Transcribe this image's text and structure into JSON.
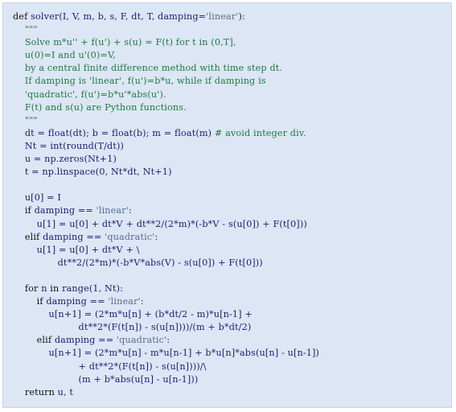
{
  "code_listing": {
    "language": "python",
    "colors": {
      "background": "#dce6f5",
      "keyword": "#111111",
      "identifier": "#1c1c70",
      "string": "#5a6e8c",
      "comment": "#1f7a3f"
    },
    "lines": [
      [
        {
          "t": "kw",
          "v": "def "
        },
        {
          "t": "id",
          "v": "solver(I, V, m, b, s, F, dt, T, damping="
        },
        {
          "t": "str",
          "v": "'linear'"
        },
        {
          "t": "id",
          "v": "):"
        }
      ],
      [
        {
          "t": "cm",
          "v": "    \"\"\""
        }
      ],
      [
        {
          "t": "cm",
          "v": "    Solve m*u'' + f(u') + s(u) = F(t) for t in (0,T],"
        }
      ],
      [
        {
          "t": "cm",
          "v": "    u(0)=I and u'(0)=V,"
        }
      ],
      [
        {
          "t": "cm",
          "v": "    by a central finite difference method with time step dt."
        }
      ],
      [
        {
          "t": "cm",
          "v": "    If damping is 'linear', f(u')=b*u, while if damping is"
        }
      ],
      [
        {
          "t": "cm",
          "v": "    'quadratic', f(u')=b*u'*abs(u')."
        }
      ],
      [
        {
          "t": "cm",
          "v": "    F(t) and s(u) are Python functions."
        }
      ],
      [
        {
          "t": "cm",
          "v": "    \"\"\""
        }
      ],
      [
        {
          "t": "id",
          "v": "    dt = float(dt); b = float(b); m = float(m) "
        },
        {
          "t": "cm",
          "v": "# avoid integer div."
        }
      ],
      [
        {
          "t": "id",
          "v": "    Nt = int(round(T/dt))"
        }
      ],
      [
        {
          "t": "id",
          "v": "    u = np.zeros(Nt+1)"
        }
      ],
      [
        {
          "t": "id",
          "v": "    t = np.linspace(0, Nt*dt, Nt+1)"
        }
      ],
      [
        {
          "t": "id",
          "v": ""
        }
      ],
      [
        {
          "t": "id",
          "v": "    u[0] = I"
        }
      ],
      [
        {
          "t": "kw",
          "v": "    if "
        },
        {
          "t": "id",
          "v": "damping == "
        },
        {
          "t": "str",
          "v": "'linear'"
        },
        {
          "t": "id",
          "v": ":"
        }
      ],
      [
        {
          "t": "id",
          "v": "        u[1] = u[0] + dt*V + dt**2/(2*m)*(-b*V - s(u[0]) + F(t[0]))"
        }
      ],
      [
        {
          "t": "kw",
          "v": "    elif "
        },
        {
          "t": "id",
          "v": "damping == "
        },
        {
          "t": "str",
          "v": "'quadratic'"
        },
        {
          "t": "id",
          "v": ":"
        }
      ],
      [
        {
          "t": "id",
          "v": "        u[1] = u[0] + dt*V + \\"
        }
      ],
      [
        {
          "t": "id",
          "v": "               dt**2/(2*m)*(-b*V*abs(V) - s(u[0]) + F(t[0]))"
        }
      ],
      [
        {
          "t": "id",
          "v": ""
        }
      ],
      [
        {
          "t": "kw",
          "v": "    for "
        },
        {
          "t": "id",
          "v": "n "
        },
        {
          "t": "kw",
          "v": "in "
        },
        {
          "t": "id",
          "v": "range(1, Nt):"
        }
      ],
      [
        {
          "t": "kw",
          "v": "        if "
        },
        {
          "t": "id",
          "v": "damping == "
        },
        {
          "t": "str",
          "v": "'linear'"
        },
        {
          "t": "id",
          "v": ":"
        }
      ],
      [
        {
          "t": "id",
          "v": "            u[n+1] = (2*m*u[n] + (b*dt/2 - m)*u[n-1] +"
        }
      ],
      [
        {
          "t": "id",
          "v": "                      dt**2*(F(t[n]) - s(u[n])))/(m + b*dt/2)"
        }
      ],
      [
        {
          "t": "kw",
          "v": "        elif "
        },
        {
          "t": "id",
          "v": "damping == "
        },
        {
          "t": "str",
          "v": "'quadratic'"
        },
        {
          "t": "id",
          "v": ":"
        }
      ],
      [
        {
          "t": "id",
          "v": "            u[n+1] = (2*m*u[n] - m*u[n-1] + b*u[n]*abs(u[n] - u[n-1])"
        }
      ],
      [
        {
          "t": "id",
          "v": "                      + dt**2*(F(t[n]) - s(u[n])))/\\"
        }
      ],
      [
        {
          "t": "id",
          "v": "                      (m + b*abs(u[n] - u[n-1]))"
        }
      ],
      [
        {
          "t": "kw",
          "v": "    return "
        },
        {
          "t": "id",
          "v": "u, t"
        }
      ]
    ]
  }
}
